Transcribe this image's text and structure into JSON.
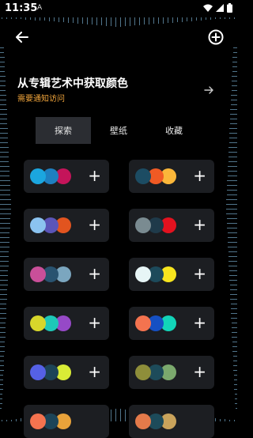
{
  "status_bar": {
    "time": "11:35",
    "mini_icon": "A"
  },
  "header": {
    "back_icon": "back-arrow-icon",
    "add_icon": "plus-circle-icon"
  },
  "banner": {
    "title": "从专辑艺术中获取颜色",
    "subtitle": "需要通知访问",
    "subtitle_color": "#f0a43b"
  },
  "tabs": [
    {
      "label": "探索",
      "active": true
    },
    {
      "label": "壁纸",
      "active": false
    },
    {
      "label": "收藏",
      "active": false
    }
  ],
  "add_label": "+",
  "palettes": [
    [
      "#1ba6df",
      "#1e7fc0",
      "#c4145a"
    ],
    [
      "#1c4c63",
      "#f05a24",
      "#fbb73a"
    ],
    [
      "#8bc3f0",
      "#5b55b8",
      "#e2541f"
    ],
    [
      "#7a8b91",
      "#1f3a4a",
      "#e3121f"
    ],
    [
      "#c94f99",
      "#295370",
      "#7ba6bf"
    ],
    [
      "#e7f5f6",
      "#1d4a5b",
      "#f7e51e"
    ],
    [
      "#d7d62b",
      "#1ec8b8",
      "#9649c7"
    ],
    [
      "#f4734f",
      "#1550c3",
      "#12d4b8"
    ],
    [
      "#5561e6",
      "#1c4458",
      "#d9ec36"
    ],
    [
      "#8e8e3a",
      "#1d4b5a",
      "#7ba96d"
    ]
  ]
}
